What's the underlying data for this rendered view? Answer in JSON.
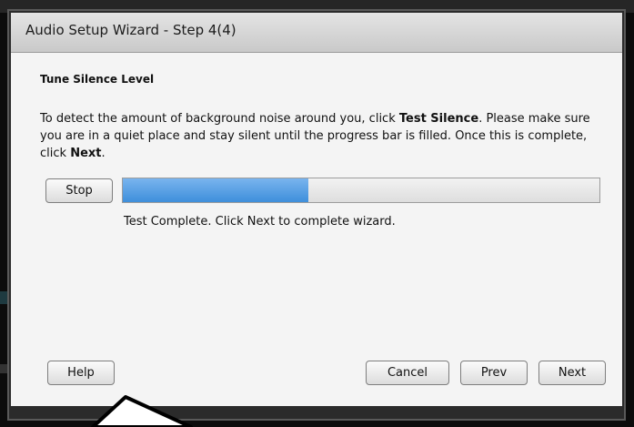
{
  "dialog": {
    "title": "Audio Setup Wizard - Step 4(4)"
  },
  "content": {
    "heading": "Tune Silence Level",
    "desc_part1": "To detect the amount of background noise around you, click ",
    "desc_bold1": "Test Silence",
    "desc_part2": ". Please make sure you are in a quiet place and stay silent until the progress bar is filled. Once this is complete, click ",
    "desc_bold2": "Next",
    "desc_part3": ".",
    "stop_label": "Stop",
    "progress_fraction": 0.39,
    "status_text": "Test Complete. Click Next to complete wizard."
  },
  "footer": {
    "help_label": "Help",
    "cancel_label": "Cancel",
    "prev_label": "Prev",
    "next_label": "Next"
  },
  "colors": {
    "progress_fill": "#4a97e0",
    "titlebar": "#d6d6d6",
    "body": "#f4f4f4"
  }
}
